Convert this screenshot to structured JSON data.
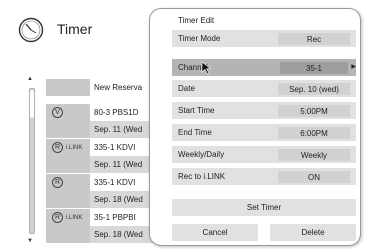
{
  "header": {
    "app_icon": "clock-icon",
    "title": "Timer"
  },
  "scrollbar": {
    "up_icon": "triangle-up-icon",
    "down_icon": "triangle-down-icon"
  },
  "timer_list": {
    "header_text": "New Reserva",
    "rows": [
      {
        "badge": "V",
        "link": "",
        "text": "80-3  PBS1D",
        "style": "dark"
      },
      {
        "badge": "",
        "link": "",
        "text": "Sep. 11 (Wed",
        "style": "light"
      },
      {
        "badge": "R",
        "link": "i.LINK",
        "text": "335-1  KDVI",
        "style": "dark"
      },
      {
        "badge": "",
        "link": "",
        "text": "Sep. 11 (Wed",
        "style": "light"
      },
      {
        "badge": "R",
        "link": "",
        "text": "335-1  KDVI",
        "style": "dark"
      },
      {
        "badge": "",
        "link": "",
        "text": "Sep. 18 (Wed",
        "style": "light"
      },
      {
        "badge": "R",
        "link": "i.LINK",
        "text": "35-1  PBPBI",
        "style": "dark"
      },
      {
        "badge": "",
        "link": "",
        "text": "Sep. 18 (Wed",
        "style": "light"
      }
    ]
  },
  "dialog": {
    "title": "Timer Edit",
    "fields": {
      "timer_mode": {
        "label": "Timer Mode",
        "value": "Rec"
      },
      "channel": {
        "label": "Channel",
        "value": "35-1",
        "left_arrow": "triangle-left-icon",
        "right_arrow": "triangle-right-icon"
      },
      "date": {
        "label": "Date",
        "value": "Sep. 10 (wed)"
      },
      "start_time": {
        "label": "Start Time",
        "value": "5:00PM"
      },
      "end_time": {
        "label": "End Time",
        "value": "6:00PM"
      },
      "weekly_daily": {
        "label": "Weekly/Daily",
        "value": "Weekly"
      },
      "rec_to_ilink": {
        "label": "Rec to i.LINK",
        "value": "ON"
      }
    },
    "buttons": {
      "set_timer": "Set Timer",
      "cancel": "Cancel",
      "delete": "Delete"
    }
  },
  "cursor": "pointer-arrow-icon"
}
